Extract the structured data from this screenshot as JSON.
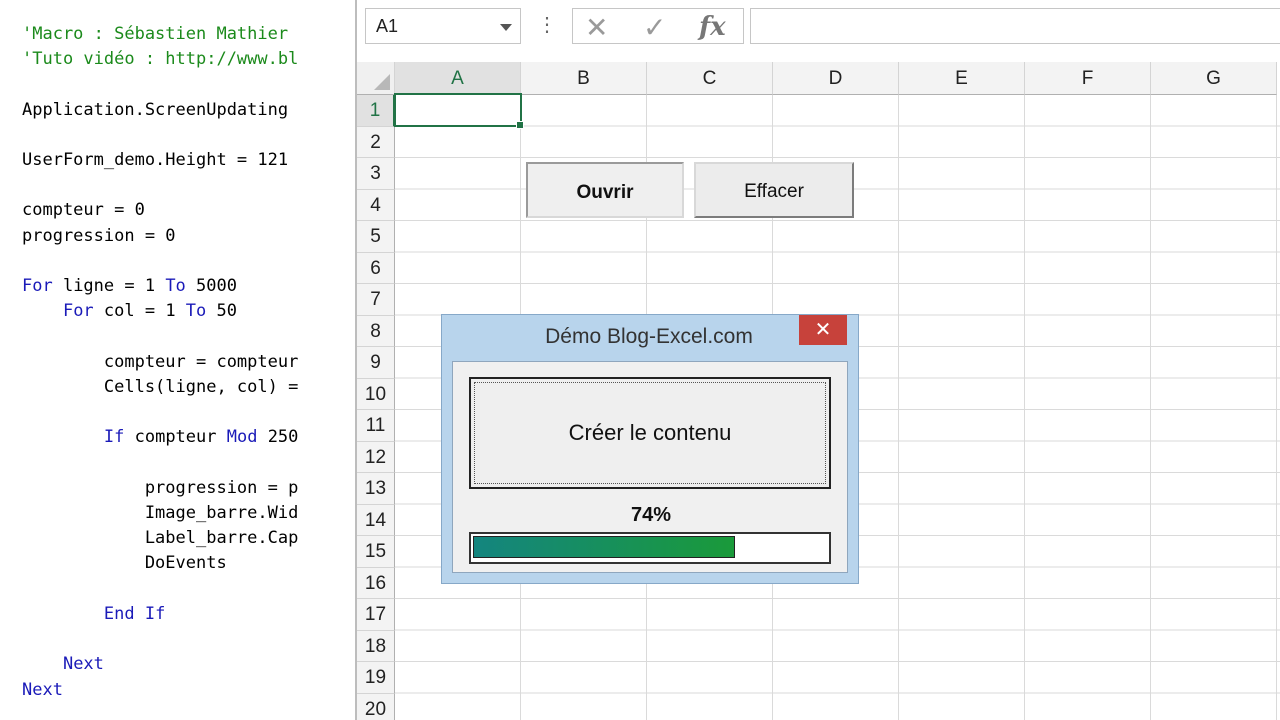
{
  "code_lines": [
    {
      "text": "'Macro : Sébastien Mathier",
      "type": "comment"
    },
    {
      "text": "'Tuto vidéo : http://www.bl",
      "type": "comment"
    },
    {
      "text": "Application.ScreenUpdating",
      "type": "code"
    },
    {
      "text": "UserForm_demo.Height = 121",
      "type": "code"
    },
    {
      "text": "compteur = 0",
      "type": "code"
    },
    {
      "text": "progression = 0",
      "type": "code"
    },
    {
      "text": "For ligne = 1 To 5000",
      "type": "code"
    },
    {
      "text": "    For col = 1 To 50",
      "type": "code"
    },
    {
      "text": "        compteur = compteur",
      "type": "code"
    },
    {
      "text": "        Cells(ligne, col) =",
      "type": "code"
    },
    {
      "text": "        If compteur Mod 250",
      "type": "code"
    },
    {
      "text": "            progression = p",
      "type": "code"
    },
    {
      "text": "            Image_barre.Wid",
      "type": "code"
    },
    {
      "text": "            Label_barre.Cap",
      "type": "code"
    },
    {
      "text": "            DoEvents",
      "type": "code"
    },
    {
      "text": "        End If",
      "type": "code"
    },
    {
      "text": "    Next",
      "type": "code"
    },
    {
      "text": "Next",
      "type": "code"
    }
  ],
  "formula_bar": {
    "name_box": "A1",
    "more_icon": "⋮",
    "cancel_icon": "✕",
    "enter_icon": "✓",
    "fx_label": "fx",
    "formula": ""
  },
  "columns": [
    "A",
    "B",
    "C",
    "D",
    "E",
    "F",
    "G"
  ],
  "rows": [
    "1",
    "2",
    "3",
    "4",
    "5",
    "6",
    "7",
    "8",
    "9",
    "10",
    "11",
    "12",
    "13",
    "14",
    "15",
    "16",
    "17",
    "18",
    "19",
    "20"
  ],
  "selected_cell": "A1",
  "sheet_buttons": {
    "ouvrir": "Ouvrir",
    "effacer": "Effacer"
  },
  "userform": {
    "title": "Démo Blog-Excel.com",
    "close": "✕",
    "create_button": "Créer le contenu",
    "progress_label": "74%",
    "progress": 0.74
  },
  "colors": {
    "excel_green": "#217346",
    "comment_green": "#1b8a1b",
    "keyword_blue": "#1a1ab8",
    "form_frame": "#b8d4ec",
    "close_red": "#c7423b"
  }
}
